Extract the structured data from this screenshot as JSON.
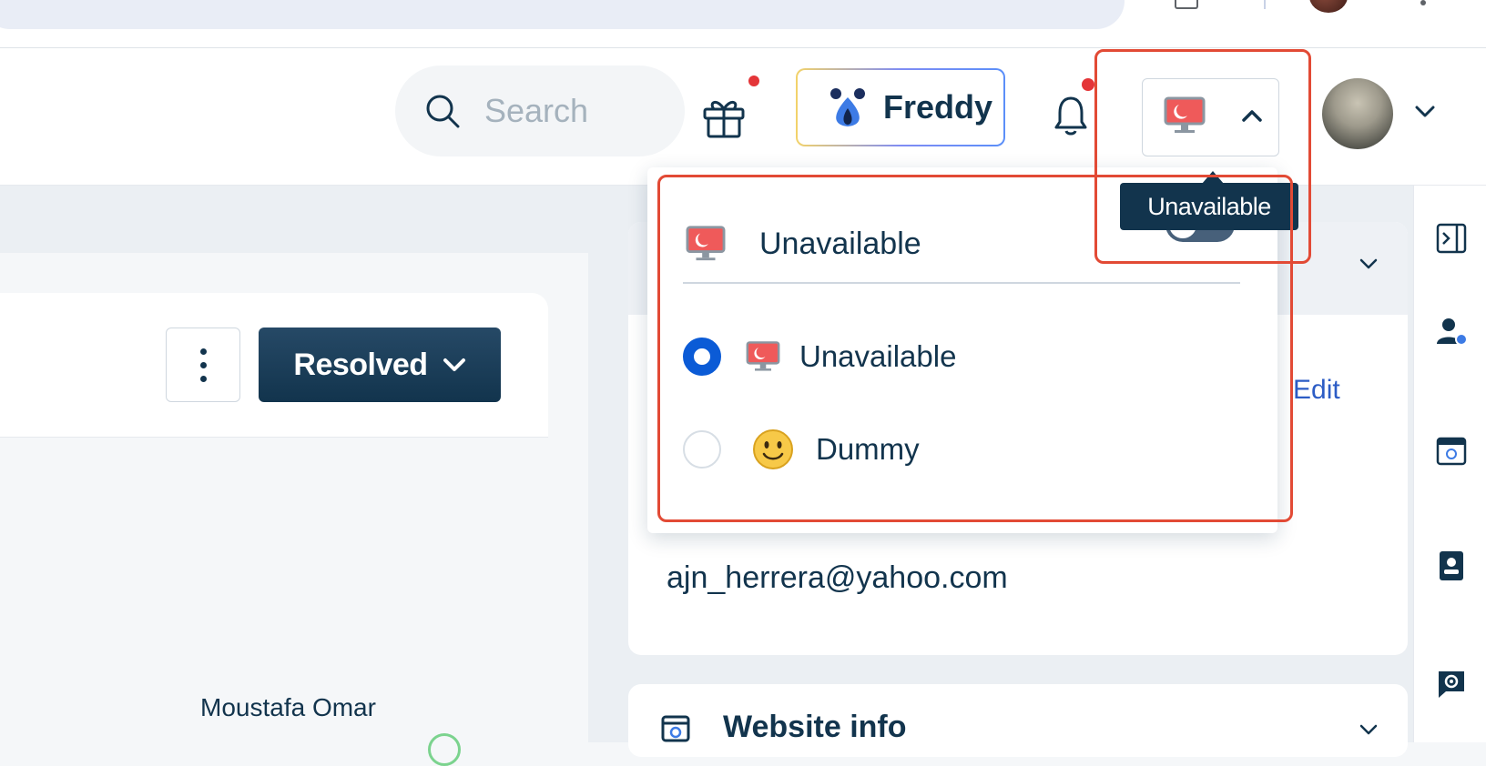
{
  "header": {
    "search_placeholder": "Search",
    "freddy_label": "Freddy",
    "status_tooltip": "Unavailable",
    "notification_dot_color": "#e43538"
  },
  "status_dropdown": {
    "current_status": "Unavailable",
    "options": [
      {
        "label": "Unavailable",
        "icon": "monitor-away-icon",
        "selected": true
      },
      {
        "label": "Dummy",
        "icon": "smiley-icon",
        "selected": false
      }
    ]
  },
  "ticket": {
    "status_button_label": "Resolved",
    "agent_name": "Moustafa Omar"
  },
  "contact_panel": {
    "edit_label": "Edit",
    "email": "ajn_herrera@yahoo.com",
    "website_info_title": "Website info"
  },
  "colors": {
    "primary_dark": "#12344d",
    "radio_selected": "#0b5bd6",
    "highlight": "#e24a35",
    "link": "#2c5cc5"
  }
}
